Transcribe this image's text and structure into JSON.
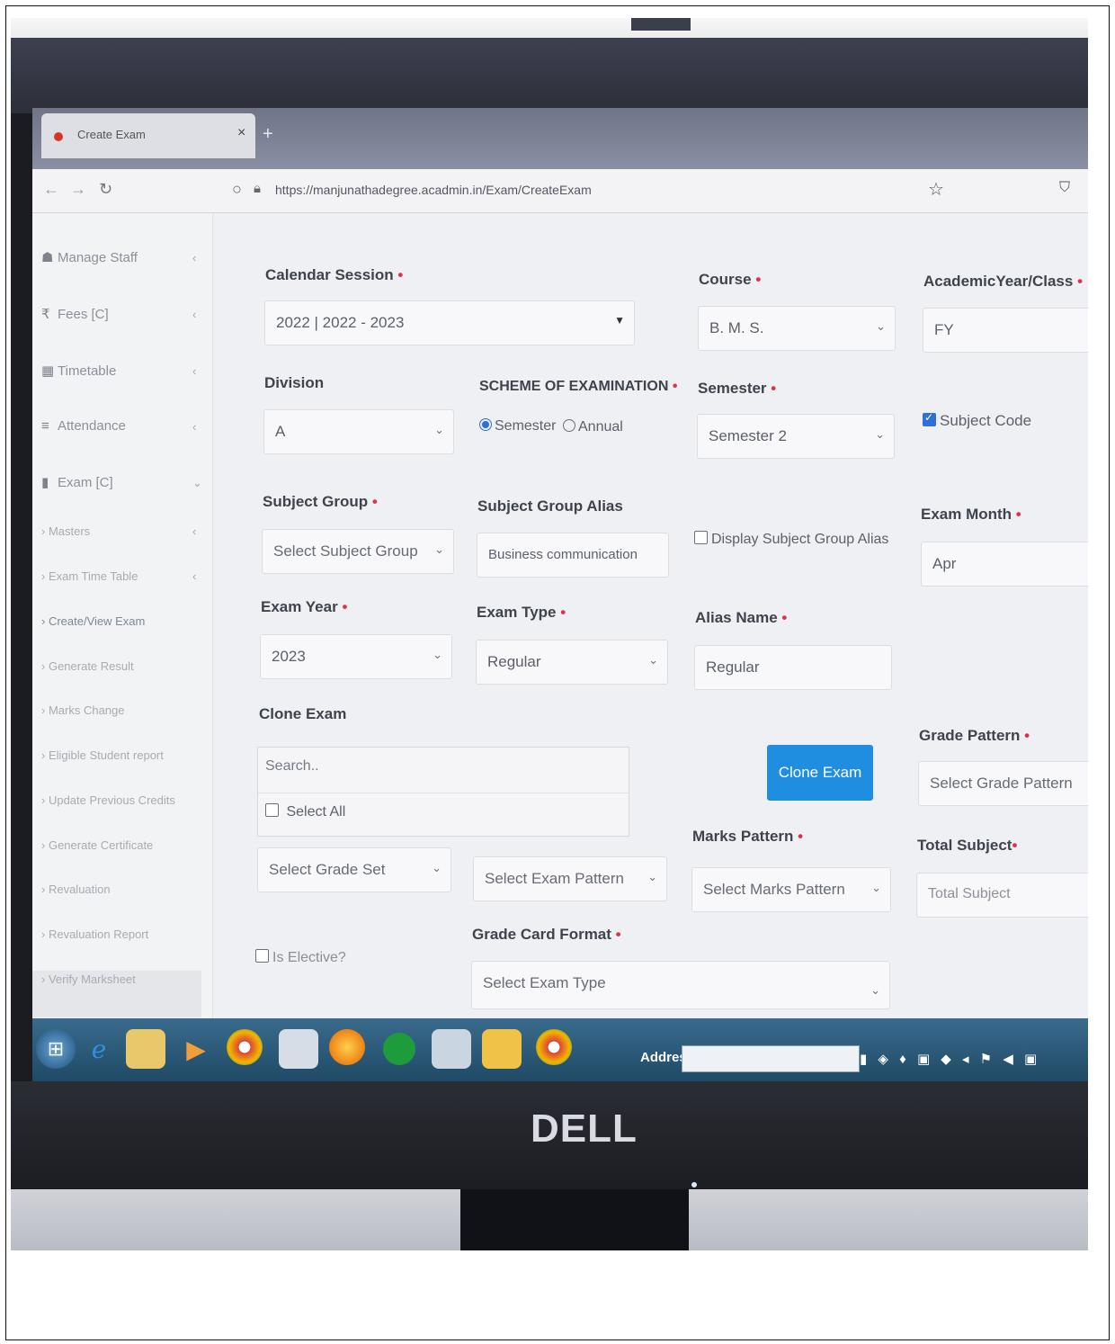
{
  "browser": {
    "tab_title": "Create Exam",
    "tab_close": "×",
    "new_tab": "+",
    "url": "https://manjunathadegree.acadmin.in/Exam/CreateExam"
  },
  "sidebar": {
    "items": [
      {
        "label": "Manage Staff",
        "icon": "staff-icon"
      },
      {
        "label": "Fees [C]",
        "icon": "rupee-icon"
      },
      {
        "label": "Timetable",
        "icon": "calendar-icon"
      },
      {
        "label": "Attendance",
        "icon": "list-icon"
      },
      {
        "label": "Exam [C]",
        "icon": "exam-icon"
      }
    ],
    "subitems": [
      "Masters",
      "Exam Time Table",
      "Create/View Exam",
      "Generate Result",
      "Marks Change",
      "Eligible Student report",
      "Update Previous Credits",
      "Generate Certificate",
      "Revaluation",
      "Revaluation Report",
      "Verify Marksheet"
    ]
  },
  "form": {
    "calendar_session": {
      "label": "Calendar Session",
      "value": "2022 | 2022 - 2023"
    },
    "course": {
      "label": "Course",
      "value": "B. M. S."
    },
    "academic_year": {
      "label": "AcademicYear/Class",
      "value": "FY"
    },
    "division": {
      "label": "Division",
      "value": "A"
    },
    "scheme": {
      "label": "SCHEME OF EXAMINATION",
      "option1": "Semester",
      "option2": "Annual"
    },
    "semester": {
      "label": "Semester",
      "value": "Semester 2"
    },
    "subject_code": {
      "label": "Subject Code"
    },
    "subject_group": {
      "label": "Subject Group",
      "value": "Select Subject Group"
    },
    "subject_group_alias": {
      "label": "Subject Group Alias",
      "value": "Business communication"
    },
    "display_alias": {
      "label": "Display Subject Group Alias"
    },
    "exam_month": {
      "label": "Exam Month",
      "value": "Apr"
    },
    "exam_year": {
      "label": "Exam Year",
      "value": "2023"
    },
    "exam_type": {
      "label": "Exam Type",
      "value": "Regular"
    },
    "alias_name": {
      "label": "Alias Name",
      "value": "Regular"
    },
    "clone_exam": {
      "label": "Clone Exam",
      "search_placeholder": "Search..",
      "select_all": "Select All",
      "button": "Clone Exam"
    },
    "grade_pattern": {
      "label": "Grade Pattern",
      "value": "Select Grade Pattern"
    },
    "grade_set": {
      "value": "Select Grade Set"
    },
    "exam_pattern": {
      "value": "Select Exam Pattern"
    },
    "marks_pattern": {
      "label": "Marks Pattern",
      "value": "Select Marks Pattern"
    },
    "total_subject": {
      "label": "Total Subject",
      "placeholder": "Total Subject"
    },
    "is_elective": {
      "label": "Is Elective?"
    },
    "grade_card_format": {
      "label": "Grade Card Format",
      "value": "Select Exam Type"
    }
  },
  "taskbar": {
    "address_label": "Address"
  },
  "monitor": {
    "brand": "DELL"
  },
  "colors": {
    "accent": "#1f8ee0",
    "required": "#e0314b",
    "taskbar": "#2b5b7c"
  }
}
